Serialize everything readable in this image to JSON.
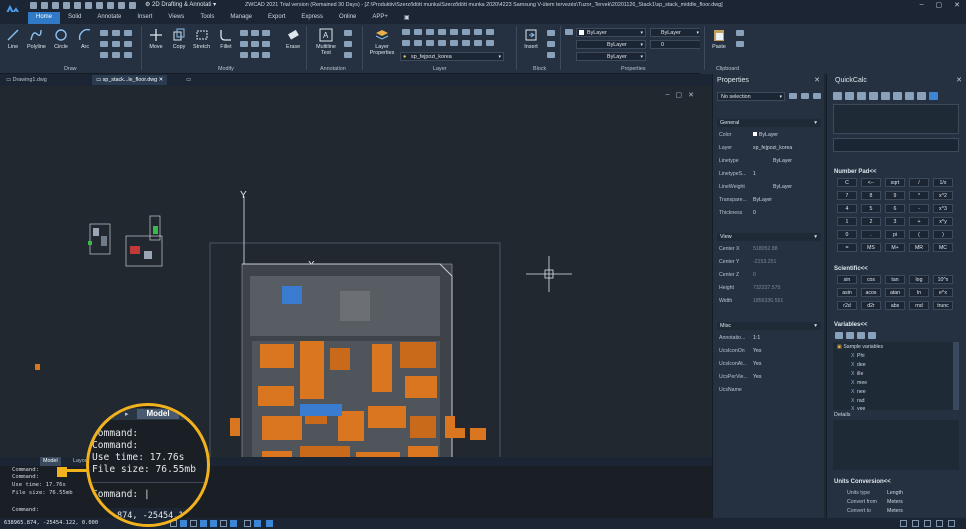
{
  "app": {
    "workspace": "2D Drafting & Annotati",
    "title": "ZWCAD 2021 Trial version (Remained 30 Days) - [Z:\\Produktiv\\Szerződött munka\\Szerződött munka 2020\\4223 Samsung V-ütem tervezés\\Tuzor_Tervek\\20201126_Stack1\\sp_stack_middle_floor.dwg]"
  },
  "menu": [
    "Home",
    "Solid",
    "Annotate",
    "Insert",
    "Views",
    "Tools",
    "Manage",
    "Export",
    "Express",
    "Online",
    "APP+"
  ],
  "ribbon": {
    "draw": {
      "label": "Draw",
      "line": "Line",
      "polyline": "Polyline",
      "circle": "Circle",
      "arc": "Arc"
    },
    "modify": {
      "label": "Modify",
      "move": "Move",
      "copy": "Copy",
      "stretch": "Stretch",
      "fillet": "Fillet",
      "erase": "Erase"
    },
    "annotation": {
      "label": "Annotation",
      "mtext": "Multiline Text"
    },
    "layer": {
      "label": "Layer",
      "properties": "Layer Properties",
      "current": "sp_fejpozi_korea"
    },
    "block": {
      "label": "Block",
      "insert": "Insert"
    },
    "properties": {
      "label": "Properties",
      "bylayer1": "ByLayer",
      "bylayer2": "ByLayer",
      "bylayer3": "ByLayer",
      "bylayer4": "ByLayer",
      "value": "0"
    },
    "clipboard": {
      "label": "Clipboard",
      "paste": "Paste"
    }
  },
  "doc_tabs": [
    "Drawing1.dwg",
    "sp_stack...le_floor.dwg"
  ],
  "canvas": {
    "y_axis": "Y",
    "x_axis": "X"
  },
  "model_tabs": [
    "Model",
    "Layout1"
  ],
  "command": {
    "lines": [
      "Command:",
      "Command:",
      "Use time: 17.76s",
      "File size: 76.55mb"
    ],
    "prompt": "Command:",
    "coords": "638965.874, -25454.122, 0.000"
  },
  "magnifier": {
    "tab": "Model",
    "lines": [
      "Command:",
      "Command:",
      "Use time: 17.76s",
      "File size: 76.55mb"
    ],
    "prompt": "Command:",
    "coords_partial": "874, -25454.12"
  },
  "properties": {
    "title": "Properties",
    "selection": "No selection",
    "general": {
      "label": "General",
      "rows": [
        {
          "k": "Color",
          "v": "ByLayer"
        },
        {
          "k": "Layer",
          "v": "sp_fejpozi_korea"
        },
        {
          "k": "Linetype",
          "v": "ByLayer"
        },
        {
          "k": "LinetypeS...",
          "v": "1"
        },
        {
          "k": "LineWeight",
          "v": "ByLayer"
        },
        {
          "k": "Transpare...",
          "v": "ByLayer"
        },
        {
          "k": "Thickness",
          "v": "0"
        }
      ]
    },
    "view": {
      "label": "View",
      "rows": [
        {
          "k": "Center X",
          "v": "518052.88"
        },
        {
          "k": "Center Y",
          "v": "-2153.251"
        },
        {
          "k": "Center Z",
          "v": "0"
        },
        {
          "k": "Height",
          "v": "732237.575"
        },
        {
          "k": "Width",
          "v": "1856336.551"
        }
      ]
    },
    "misc": {
      "label": "Misc",
      "rows": [
        {
          "k": "Annotatio...",
          "v": "1:1"
        },
        {
          "k": "UcsIconOn",
          "v": "Yes"
        },
        {
          "k": "UcsIconAt...",
          "v": "Yes"
        },
        {
          "k": "UcsPerVie...",
          "v": "Yes"
        },
        {
          "k": "UcsName",
          "v": ""
        }
      ]
    }
  },
  "quickcalc": {
    "title": "QuickCalc",
    "numpad_label": "Number Pad<<",
    "numpad": [
      [
        "C",
        "<--",
        "sqrt",
        "/",
        "1/x"
      ],
      [
        "7",
        "8",
        "9",
        "*",
        "x^2"
      ],
      [
        "4",
        "5",
        "6",
        "-",
        "x^3"
      ],
      [
        "1",
        "2",
        "3",
        "+",
        "x^y"
      ],
      [
        "0",
        ".",
        "pi",
        "(",
        ")"
      ],
      [
        "=",
        "MS",
        "M+",
        "MR",
        "MC"
      ]
    ],
    "scientific_label": "Scientific<<",
    "scientific": [
      [
        "sin",
        "cos",
        "tan",
        "log",
        "10^x"
      ],
      [
        "asin",
        "acos",
        "atan",
        "ln",
        "e^x"
      ],
      [
        "r2d",
        "d2r",
        "abs",
        "rnd",
        "trunc"
      ]
    ],
    "variables_label": "Variables<<",
    "variables_root": "Sample variables",
    "variables": [
      "Phi",
      "dee",
      "ille",
      "mee",
      "nee",
      "rad",
      "vee"
    ],
    "details": "Details",
    "units_label": "Units Conversion<<",
    "units": [
      {
        "k": "Units type",
        "v": "Length"
      },
      {
        "k": "Convert from",
        "v": "Meters"
      },
      {
        "k": "Convert to",
        "v": "Meters"
      }
    ]
  },
  "colors": {
    "accent": "#2f79c7",
    "highlight": "#f2b21d",
    "drawing": "#d9761f"
  }
}
